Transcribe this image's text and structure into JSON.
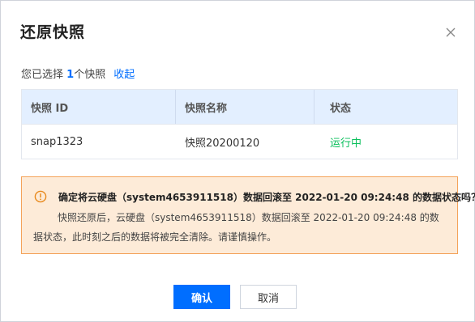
{
  "dialog": {
    "title": "还原快照",
    "close_icon": "close-icon"
  },
  "selection": {
    "prefix": "您已选择 ",
    "count": "1",
    "suffix": "个快照",
    "collapse_label": "收起"
  },
  "table": {
    "headers": [
      "快照 ID",
      "快照名称",
      "状态"
    ],
    "rows": [
      {
        "id": "snap1323",
        "name": "快照20200120",
        "status": "运行中"
      }
    ]
  },
  "warning": {
    "icon": "warning-circle-icon",
    "title": "确定将云硬盘（system4653911518）数据回滚至 2022-01-20 09:24:48 的数据状态吗？",
    "body": "快照还原后，云硬盘（system4653911518）数据回滚至 2022-01-20 09:24:48 的数据状态，此时刻之后的数据将被完全清除。请谨慎操作。"
  },
  "buttons": {
    "confirm_label": "确认",
    "cancel_label": "取消"
  },
  "colors": {
    "primary": "#006eff",
    "success": "#0abf5b",
    "warning_bg": "#fdebd8",
    "warning_border": "#f4a35a",
    "table_header_bg": "#e3efff"
  }
}
